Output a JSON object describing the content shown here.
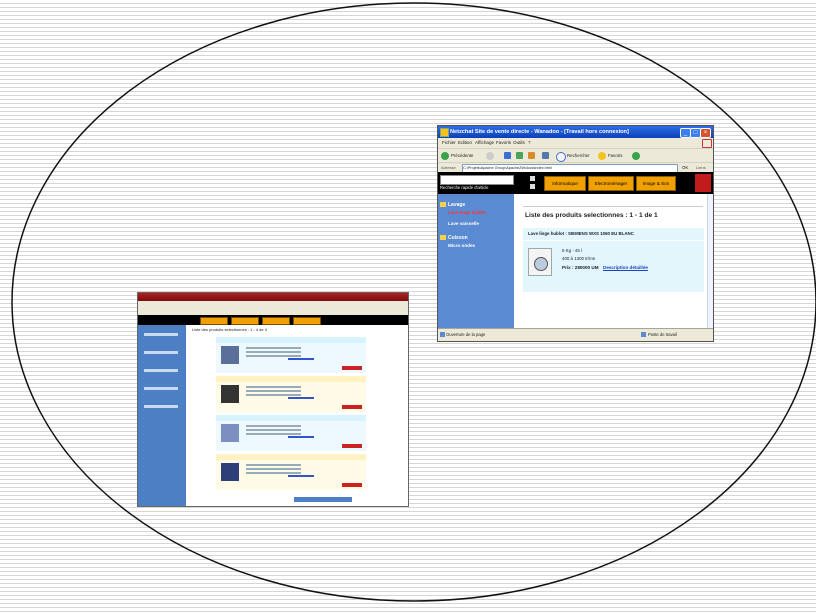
{
  "slide": {
    "background_line_color": "#d6d6d6"
  },
  "screenshot_small": {
    "list_title": "Liste des produits selectionnes : 1 - 4 de 4"
  },
  "browser": {
    "title": "Netzchat Site de vente directe - Wanadoo - [Travail hors connexion]",
    "menu": [
      "Fichier",
      "Edition",
      "Affichage",
      "Favoris",
      "Outils",
      "?"
    ],
    "toolbar": {
      "back": "Précédente",
      "search": "Rechercher",
      "favorites": "Favoris"
    },
    "address": {
      "label": "Adresse",
      "value": "C:\\Projets\\Apache Group\\Apache2\\htdocs\\index.html",
      "go": "OK",
      "links": "Liens"
    },
    "site": {
      "search_label": "Recherche rapide d'article",
      "nav": [
        "Informatique",
        "Electroménager",
        "Image & Son"
      ],
      "sidebar": [
        {
          "category": "Lavage",
          "items": [
            "Lave linge hublot",
            "Lave vaisselle"
          ]
        },
        {
          "category": "Cuisson",
          "items": [
            "Micro ondes"
          ]
        }
      ],
      "list_title": "Liste des produits selectionnes : 1 - 1 de 1",
      "product": {
        "name": "Lave linge hublot : SIEMENS WXS 1060 EU BLANC",
        "capacity": "5 Kg - 45 l",
        "spin": "400 à 1300 tr/mn",
        "price": "Prix : 280000 UM",
        "details_link": "Description détaillée"
      }
    },
    "status": {
      "left": "Ouverture de la page",
      "right": "Poste de travail"
    }
  }
}
